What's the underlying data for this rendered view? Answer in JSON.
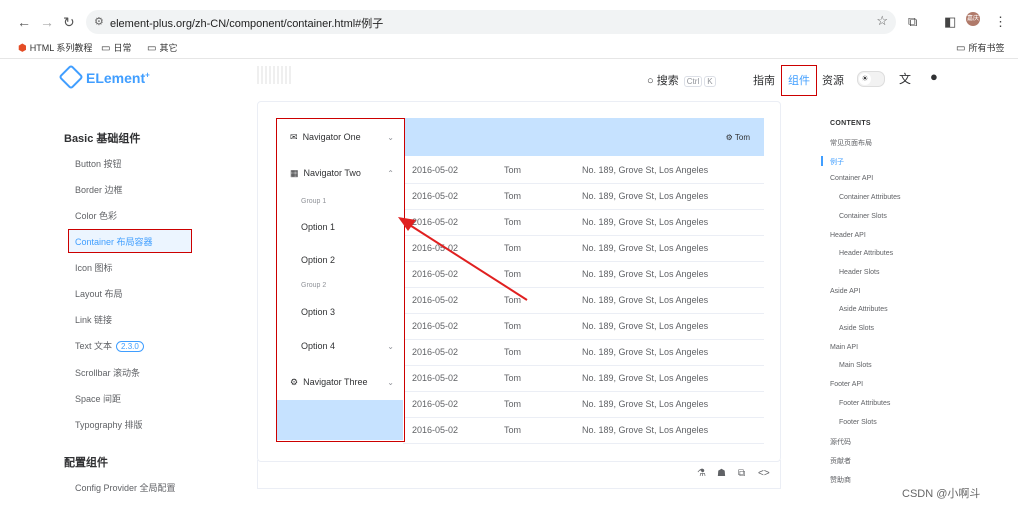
{
  "browser": {
    "url": "element-plus.org/zh-CN/component/container.html#例子",
    "bookmarks": [
      {
        "icon": "html-logo-icon",
        "label": "HTML 系列教程"
      },
      {
        "icon": "folder-icon",
        "label": "日常"
      },
      {
        "icon": "folder-icon",
        "label": "其它"
      }
    ],
    "all_bookmarks": "所有书签",
    "avatar": "嘉庆"
  },
  "site": {
    "logo": "ELement",
    "logo_sup": "+",
    "search": "搜索",
    "kbd1": "Ctrl",
    "kbd2": "K",
    "nav": [
      "指南",
      "组件",
      "资源"
    ],
    "active_nav": "组件"
  },
  "sidebar": {
    "section1": "Basic 基础组件",
    "items": [
      "Button 按钮",
      "Border 边框",
      "Color 色彩",
      "Container 布局容器",
      "Icon 图标",
      "Layout 布局",
      "Link 链接",
      "Text 文本",
      "Scrollbar 滚动条",
      "Space 间距",
      "Typography 排版"
    ],
    "text_badge": "2.3.0",
    "section2": "配置组件",
    "section2_items": [
      "Config Provider 全局配置"
    ]
  },
  "demo": {
    "aside": {
      "nav1": "Navigator One",
      "nav2": "Navigator Two",
      "group1": "Group 1",
      "opt1": "Option 1",
      "opt2": "Option 2",
      "group2": "Group 2",
      "opt3": "Option 3",
      "opt4": "Option 4",
      "nav3": "Navigator Three"
    },
    "header_user": "Tom",
    "table": {
      "rows": [
        [
          "2016-05-02",
          "Tom",
          "No. 189, Grove St, Los Angeles"
        ],
        [
          "2016-05-02",
          "Tom",
          "No. 189, Grove St, Los Angeles"
        ],
        [
          "2016-05-02",
          "Tom",
          "No. 189, Grove St, Los Angeles"
        ],
        [
          "2016-05-02",
          "Tom",
          "No. 189, Grove St, Los Angeles"
        ],
        [
          "2016-05-02",
          "Tom",
          "No. 189, Grove St, Los Angeles"
        ],
        [
          "2016-05-02",
          "Tom",
          "No. 189, Grove St, Los Angeles"
        ],
        [
          "2016-05-02",
          "Tom",
          "No. 189, Grove St, Los Angeles"
        ],
        [
          "2016-05-02",
          "Tom",
          "No. 189, Grove St, Los Angeles"
        ],
        [
          "2016-05-02",
          "Tom",
          "No. 189, Grove St, Los Angeles"
        ],
        [
          "2016-05-02",
          "Tom",
          "No. 189, Grove St, Los Angeles"
        ],
        [
          "2016-05-02",
          "Tom",
          "No. 189, Grove St, Los Angeles"
        ]
      ]
    }
  },
  "toc": {
    "title": "CONTENTS",
    "items": [
      {
        "label": "常见页面布局",
        "indent": 0
      },
      {
        "label": "例子",
        "indent": 0,
        "active": true
      },
      {
        "label": "Container API",
        "indent": 0
      },
      {
        "label": "Container Attributes",
        "indent": 1
      },
      {
        "label": "Container Slots",
        "indent": 1
      },
      {
        "label": "Header API",
        "indent": 0
      },
      {
        "label": "Header Attributes",
        "indent": 1
      },
      {
        "label": "Header Slots",
        "indent": 1
      },
      {
        "label": "Aside API",
        "indent": 0
      },
      {
        "label": "Aside Attributes",
        "indent": 1
      },
      {
        "label": "Aside Slots",
        "indent": 1
      },
      {
        "label": "Main API",
        "indent": 0
      },
      {
        "label": "Main Slots",
        "indent": 1
      },
      {
        "label": "Footer API",
        "indent": 0
      },
      {
        "label": "Footer Attributes",
        "indent": 1
      },
      {
        "label": "Footer Slots",
        "indent": 1
      },
      {
        "label": "源代码",
        "indent": 0
      },
      {
        "label": "贡献者",
        "indent": 0
      },
      {
        "label": "赞助商",
        "indent": 0
      }
    ]
  },
  "watermark": "CSDN @小啊斗",
  "colors": {
    "accent": "#409eff",
    "highlight_bg": "#c6e2ff",
    "annotation": "#cc0000"
  }
}
